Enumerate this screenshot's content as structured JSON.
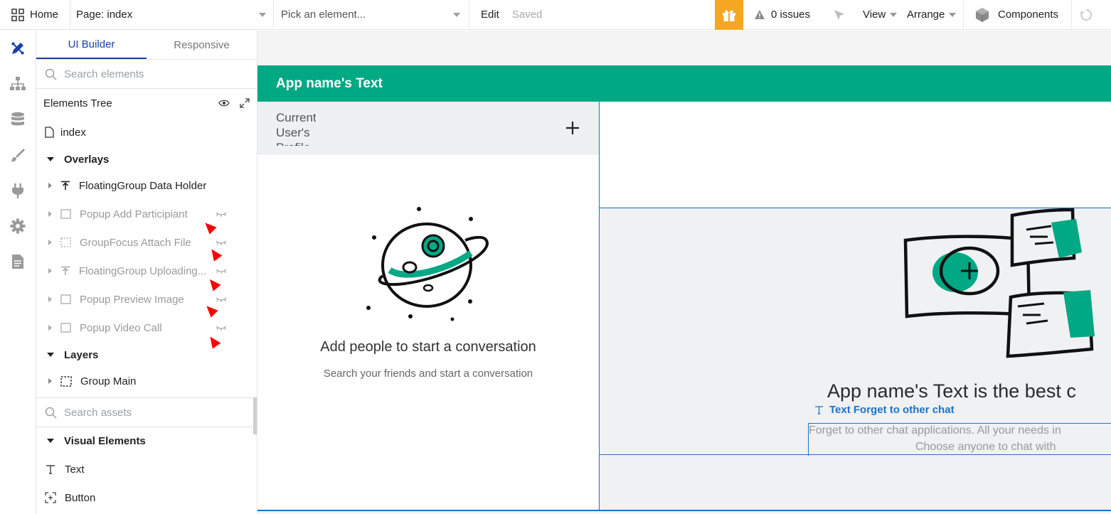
{
  "topbar": {
    "home_label": "Home",
    "page_label": "Page: index",
    "element_placeholder": "Pick an element...",
    "edit_label": "Edit",
    "saved_label": "Saved",
    "issues_label": "0 issues",
    "view_label": "View",
    "arrange_label": "Arrange",
    "components_label": "Components",
    "gift_color": "#f5a623"
  },
  "leftrail": {
    "icons": [
      "design-icon",
      "workflow-tree-icon",
      "database-icon",
      "styles-brush-icon",
      "plugins-plug-icon",
      "settings-gear-icon",
      "logs-document-icon"
    ]
  },
  "panel": {
    "tabs": [
      "UI Builder",
      "Responsive"
    ],
    "search_placeholder": "Search elements",
    "tree_title": "Elements Tree",
    "page_item": "index",
    "overlays_label": "Overlays",
    "overlays": [
      {
        "label": "FloatingGroup Data Holder",
        "hidden": false
      },
      {
        "label": "Popup Add Participiant",
        "hidden": true
      },
      {
        "label": "GroupFocus Attach File",
        "hidden": true
      },
      {
        "label": "FloatingGroup Uploading...",
        "hidden": true
      },
      {
        "label": "Popup Preview Image",
        "hidden": true
      },
      {
        "label": "Popup Video Call",
        "hidden": true
      }
    ],
    "layers_label": "Layers",
    "layers": [
      {
        "label": "Group Main"
      }
    ],
    "assets_placeholder": "Search assets",
    "visual_label": "Visual Elements",
    "visual_items": [
      "Text",
      "Button"
    ]
  },
  "canvas": {
    "app_header": "App name's Text",
    "profile_text": "Current User's Profile",
    "empty_title": "Add people to start a conversation",
    "empty_subtitle": "Search your friends and start a conversation",
    "right_title": "App name's Text is the best c",
    "text_element_label": "Text Forget to other chat",
    "right_body_line1": "Forget to other chat applications. All your needs in",
    "right_body_line2": "Choose anyone to chat with",
    "brand_color": "#00a884",
    "selection_color": "#1b73c8"
  }
}
